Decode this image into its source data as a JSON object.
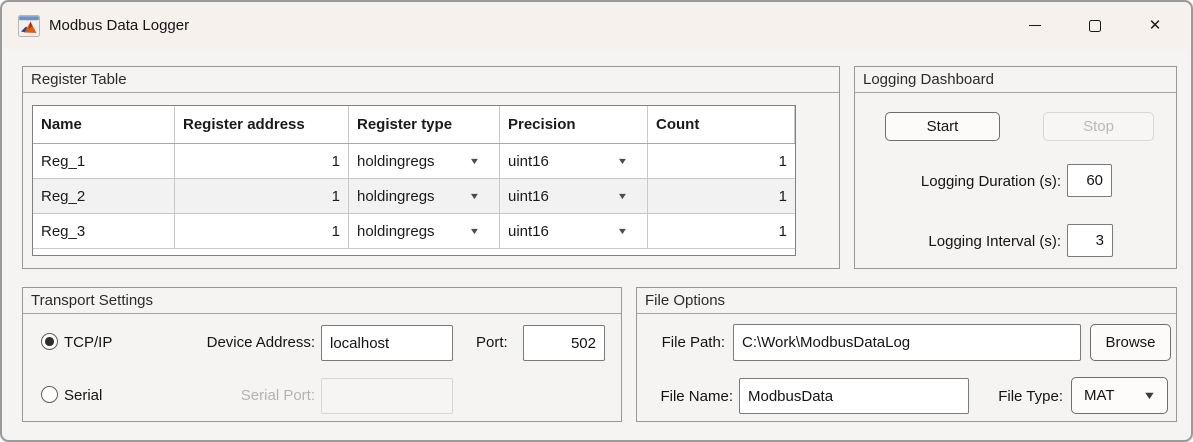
{
  "window": {
    "title": "Modbus Data Logger",
    "icons": {
      "close": "✕",
      "dropdown_arrow": "▼"
    }
  },
  "colors": {
    "titlebar_bg": "#f7f1ee",
    "canvas_bg": "#f6f4f2",
    "panel_border": "#989898",
    "field_border": "#7d7b79",
    "disabled_text": "#b5b2af",
    "table_stripe": "#f2f2f2",
    "matlab_orange": "#dd5f12",
    "matlab_blue": "#27459c"
  },
  "panels": {
    "register_table": {
      "title": "Register Table",
      "table": {
        "columns": [
          "Name",
          "Register address",
          "Register type",
          "Precision",
          "Count"
        ],
        "rows": [
          {
            "name": "Reg_1",
            "address": "1",
            "type": "holdingregs",
            "precision": "uint16",
            "count": "1"
          },
          {
            "name": "Reg_2",
            "address": "1",
            "type": "holdingregs",
            "precision": "uint16",
            "count": "1"
          },
          {
            "name": "Reg_3",
            "address": "1",
            "type": "holdingregs",
            "precision": "uint16",
            "count": "1"
          }
        ]
      }
    },
    "logging_dashboard": {
      "title": "Logging Dashboard",
      "start_label": "Start",
      "stop_label": "Stop",
      "duration_label": "Logging Duration (s):",
      "duration_value": "60",
      "interval_label": "Logging Interval (s):",
      "interval_value": "3"
    },
    "transport_settings": {
      "title": "Transport Settings",
      "tcpip_label": "TCP/IP",
      "serial_label": "Serial",
      "device_address_label": "Device Address:",
      "device_address_value": "localhost",
      "port_label": "Port:",
      "port_value": "502",
      "serial_port_label": "Serial Port:",
      "serial_port_value": ""
    },
    "file_options": {
      "title": "File Options",
      "file_path_label": "File Path:",
      "file_path_value": "C:\\Work\\ModbusDataLog",
      "browse_label": "Browse",
      "file_name_label": "File Name:",
      "file_name_value": "ModbusData",
      "file_type_label": "File Type:",
      "file_type_value": "MAT"
    }
  }
}
